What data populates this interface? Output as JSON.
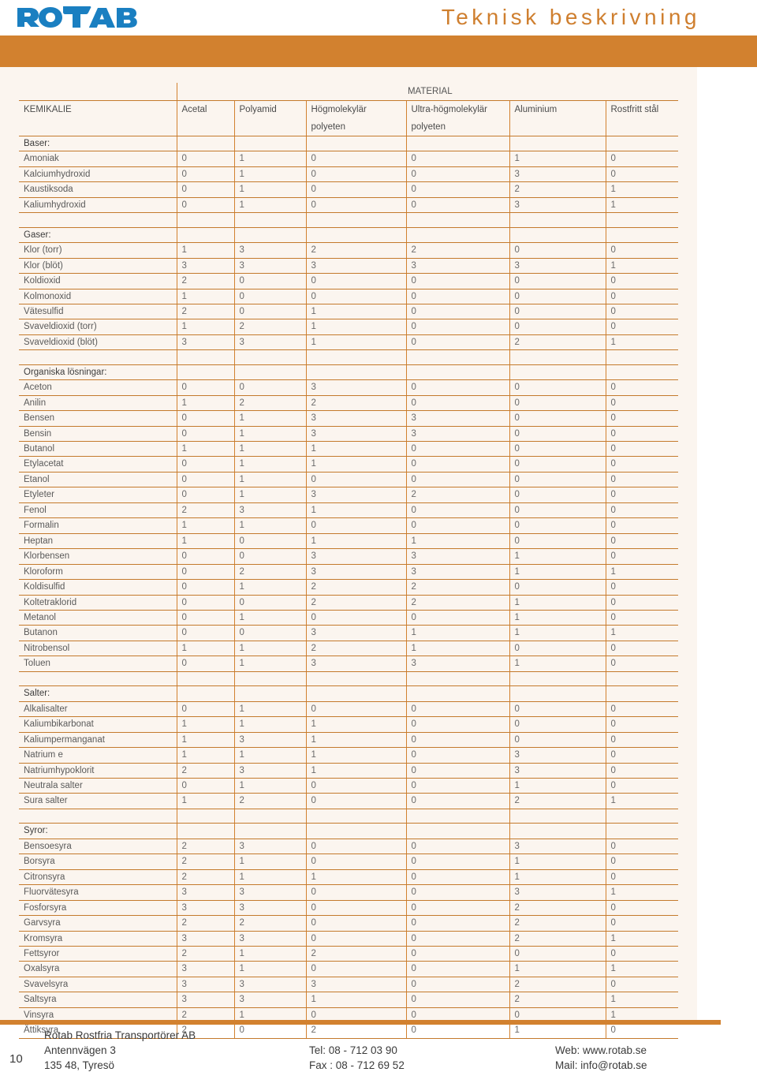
{
  "header": {
    "logo_text": "ROTAB",
    "title": "Teknisk beskrivning",
    "accent_color": "#d2812f",
    "logo_color": "#1a7fc1",
    "panel_bg": "#fbf5ef"
  },
  "table": {
    "material_group_label": "MATERIAL",
    "chemical_header": "KEMIKALIE",
    "columns": [
      {
        "line1": "Acetal",
        "line2": ""
      },
      {
        "line1": "Polyamid",
        "line2": ""
      },
      {
        "line1": "Högmolekylär",
        "line2": "polyeten"
      },
      {
        "line1": "Ultra-högmolekylär",
        "line2": "polyeten"
      },
      {
        "line1": "Aluminium",
        "line2": ""
      },
      {
        "line1": "Rostfritt stål",
        "line2": ""
      }
    ],
    "sections": [
      {
        "title": "Baser:",
        "rows": [
          {
            "name": "Amoniak",
            "values": [
              "0",
              "1",
              "0",
              "0",
              "1",
              "0"
            ]
          },
          {
            "name": "Kalciumhydroxid",
            "values": [
              "0",
              "1",
              "0",
              "0",
              "3",
              "0"
            ]
          },
          {
            "name": "Kaustiksoda",
            "values": [
              "0",
              "1",
              "0",
              "0",
              "2",
              "1"
            ]
          },
          {
            "name": "Kaliumhydroxid",
            "values": [
              "0",
              "1",
              "0",
              "0",
              "3",
              "1"
            ]
          }
        ]
      },
      {
        "title": "Gaser:",
        "rows": [
          {
            "name": "Klor (torr)",
            "values": [
              "1",
              "3",
              "2",
              "2",
              "0",
              "0"
            ]
          },
          {
            "name": "Klor (blöt)",
            "values": [
              "3",
              "3",
              "3",
              "3",
              "3",
              "1"
            ]
          },
          {
            "name": "Koldioxid",
            "values": [
              "2",
              "0",
              "0",
              "0",
              "0",
              "0"
            ]
          },
          {
            "name": "Kolmonoxid",
            "values": [
              "1",
              "0",
              "0",
              "0",
              "0",
              "0"
            ]
          },
          {
            "name": "Vätesulfid",
            "values": [
              "2",
              "0",
              "1",
              "0",
              "0",
              "0"
            ]
          },
          {
            "name": "Svaveldioxid (torr)",
            "values": [
              "1",
              "2",
              "1",
              "0",
              "0",
              "0"
            ]
          },
          {
            "name": "Svaveldioxid (blöt)",
            "values": [
              "3",
              "3",
              "1",
              "0",
              "2",
              "1"
            ]
          }
        ]
      },
      {
        "title": "Organiska lösningar:",
        "rows": [
          {
            "name": "Aceton",
            "values": [
              "0",
              "0",
              "3",
              "0",
              "0",
              "0"
            ]
          },
          {
            "name": "Anilin",
            "values": [
              "1",
              "2",
              "2",
              "0",
              "0",
              "0"
            ]
          },
          {
            "name": "Bensen",
            "values": [
              "0",
              "1",
              "3",
              "3",
              "0",
              "0"
            ]
          },
          {
            "name": "Bensin",
            "values": [
              "0",
              "1",
              "3",
              "3",
              "0",
              "0"
            ]
          },
          {
            "name": "Butanol",
            "values": [
              "1",
              "1",
              "1",
              "0",
              "0",
              "0"
            ]
          },
          {
            "name": "Etylacetat",
            "values": [
              "0",
              "1",
              "1",
              "0",
              "0",
              "0"
            ]
          },
          {
            "name": "Etanol",
            "values": [
              "0",
              "1",
              "0",
              "0",
              "0",
              "0"
            ]
          },
          {
            "name": "Etyleter",
            "values": [
              "0",
              "1",
              "3",
              "2",
              "0",
              "0"
            ]
          },
          {
            "name": "Fenol",
            "values": [
              "2",
              "3",
              "1",
              "0",
              "0",
              "0"
            ]
          },
          {
            "name": "Formalin",
            "values": [
              "1",
              "1",
              "0",
              "0",
              "0",
              "0"
            ]
          },
          {
            "name": "Heptan",
            "values": [
              "1",
              "0",
              "1",
              "1",
              "0",
              "0"
            ]
          },
          {
            "name": "Klorbensen",
            "values": [
              "0",
              "0",
              "3",
              "3",
              "1",
              "0"
            ]
          },
          {
            "name": "Kloroform",
            "values": [
              "0",
              "2",
              "3",
              "3",
              "1",
              "1"
            ]
          },
          {
            "name": "Koldisulfid",
            "values": [
              "0",
              "1",
              "2",
              "2",
              "0",
              "0"
            ]
          },
          {
            "name": "Koltetraklorid",
            "values": [
              "0",
              "0",
              "2",
              "2",
              "1",
              "0"
            ]
          },
          {
            "name": "Metanol",
            "values": [
              "0",
              "1",
              "0",
              "0",
              "1",
              "0"
            ]
          },
          {
            "name": "Butanon",
            "values": [
              "0",
              "0",
              "3",
              "1",
              "1",
              "1"
            ]
          },
          {
            "name": "Nitrobensol",
            "values": [
              "1",
              "1",
              "2",
              "1",
              "0",
              "0"
            ]
          },
          {
            "name": "Toluen",
            "values": [
              "0",
              "1",
              "3",
              "3",
              "1",
              "0"
            ]
          }
        ]
      },
      {
        "title": "Salter:",
        "rows": [
          {
            "name": "Alkalisalter",
            "values": [
              "0",
              "1",
              "0",
              "0",
              "0",
              "0"
            ]
          },
          {
            "name": "Kaliumbikarbonat",
            "values": [
              "1",
              "1",
              "1",
              "0",
              "0",
              "0"
            ]
          },
          {
            "name": "Kaliumpermanganat",
            "values": [
              "1",
              "3",
              "1",
              "0",
              "0",
              "0"
            ]
          },
          {
            "name": "Natrium e",
            "values": [
              "1",
              "1",
              "1",
              "0",
              "3",
              "0"
            ]
          },
          {
            "name": "Natriumhypoklorit",
            "values": [
              "2",
              "3",
              "1",
              "0",
              "3",
              "0"
            ]
          },
          {
            "name": "Neutrala salter",
            "values": [
              "0",
              "1",
              "0",
              "0",
              "1",
              "0"
            ]
          },
          {
            "name": "Sura salter",
            "values": [
              "1",
              "2",
              "0",
              "0",
              "2",
              "1"
            ]
          }
        ]
      },
      {
        "title": "Syror:",
        "rows": [
          {
            "name": "Bensoesyra",
            "values": [
              "2",
              "3",
              "0",
              "0",
              "3",
              "0"
            ]
          },
          {
            "name": "Borsyra",
            "values": [
              "2",
              "1",
              "0",
              "0",
              "1",
              "0"
            ]
          },
          {
            "name": "Citronsyra",
            "values": [
              "2",
              "1",
              "1",
              "0",
              "1",
              "0"
            ]
          },
          {
            "name": "Fluorvätesyra",
            "values": [
              "3",
              "3",
              "0",
              "0",
              "3",
              "1"
            ]
          },
          {
            "name": "Fosforsyra",
            "values": [
              "3",
              "3",
              "0",
              "0",
              "2",
              "0"
            ]
          },
          {
            "name": "Garvsyra",
            "values": [
              "2",
              "2",
              "0",
              "0",
              "2",
              "0"
            ]
          },
          {
            "name": "Kromsyra",
            "values": [
              "3",
              "3",
              "0",
              "0",
              "2",
              "1"
            ]
          },
          {
            "name": "Fettsyror",
            "values": [
              "2",
              "1",
              "2",
              "0",
              "0",
              "0"
            ]
          },
          {
            "name": "Oxalsyra",
            "values": [
              "3",
              "1",
              "0",
              "0",
              "1",
              "1"
            ]
          },
          {
            "name": "Svavelsyra",
            "values": [
              "3",
              "3",
              "3",
              "0",
              "2",
              "0"
            ]
          },
          {
            "name": "Saltsyra",
            "values": [
              "3",
              "3",
              "1",
              "0",
              "2",
              "1"
            ]
          },
          {
            "name": "Vinsyra",
            "values": [
              "2",
              "1",
              "0",
              "0",
              "0",
              "1"
            ]
          },
          {
            "name": "Ättiksyra",
            "values": [
              "2",
              "0",
              "2",
              "0",
              "1",
              "0"
            ]
          }
        ]
      }
    ]
  },
  "footer": {
    "page_number": "10",
    "company": "Rotab Rostfria Transportörer AB",
    "address": "Antennvägen 3",
    "city": "135 48, Tyresö",
    "tel": "Tel:  08 - 712 03 90",
    "fax": "Fax : 08 - 712 69 52",
    "web": "Web:  www.rotab.se",
    "mail": "Mail:  info@rotab.se"
  }
}
